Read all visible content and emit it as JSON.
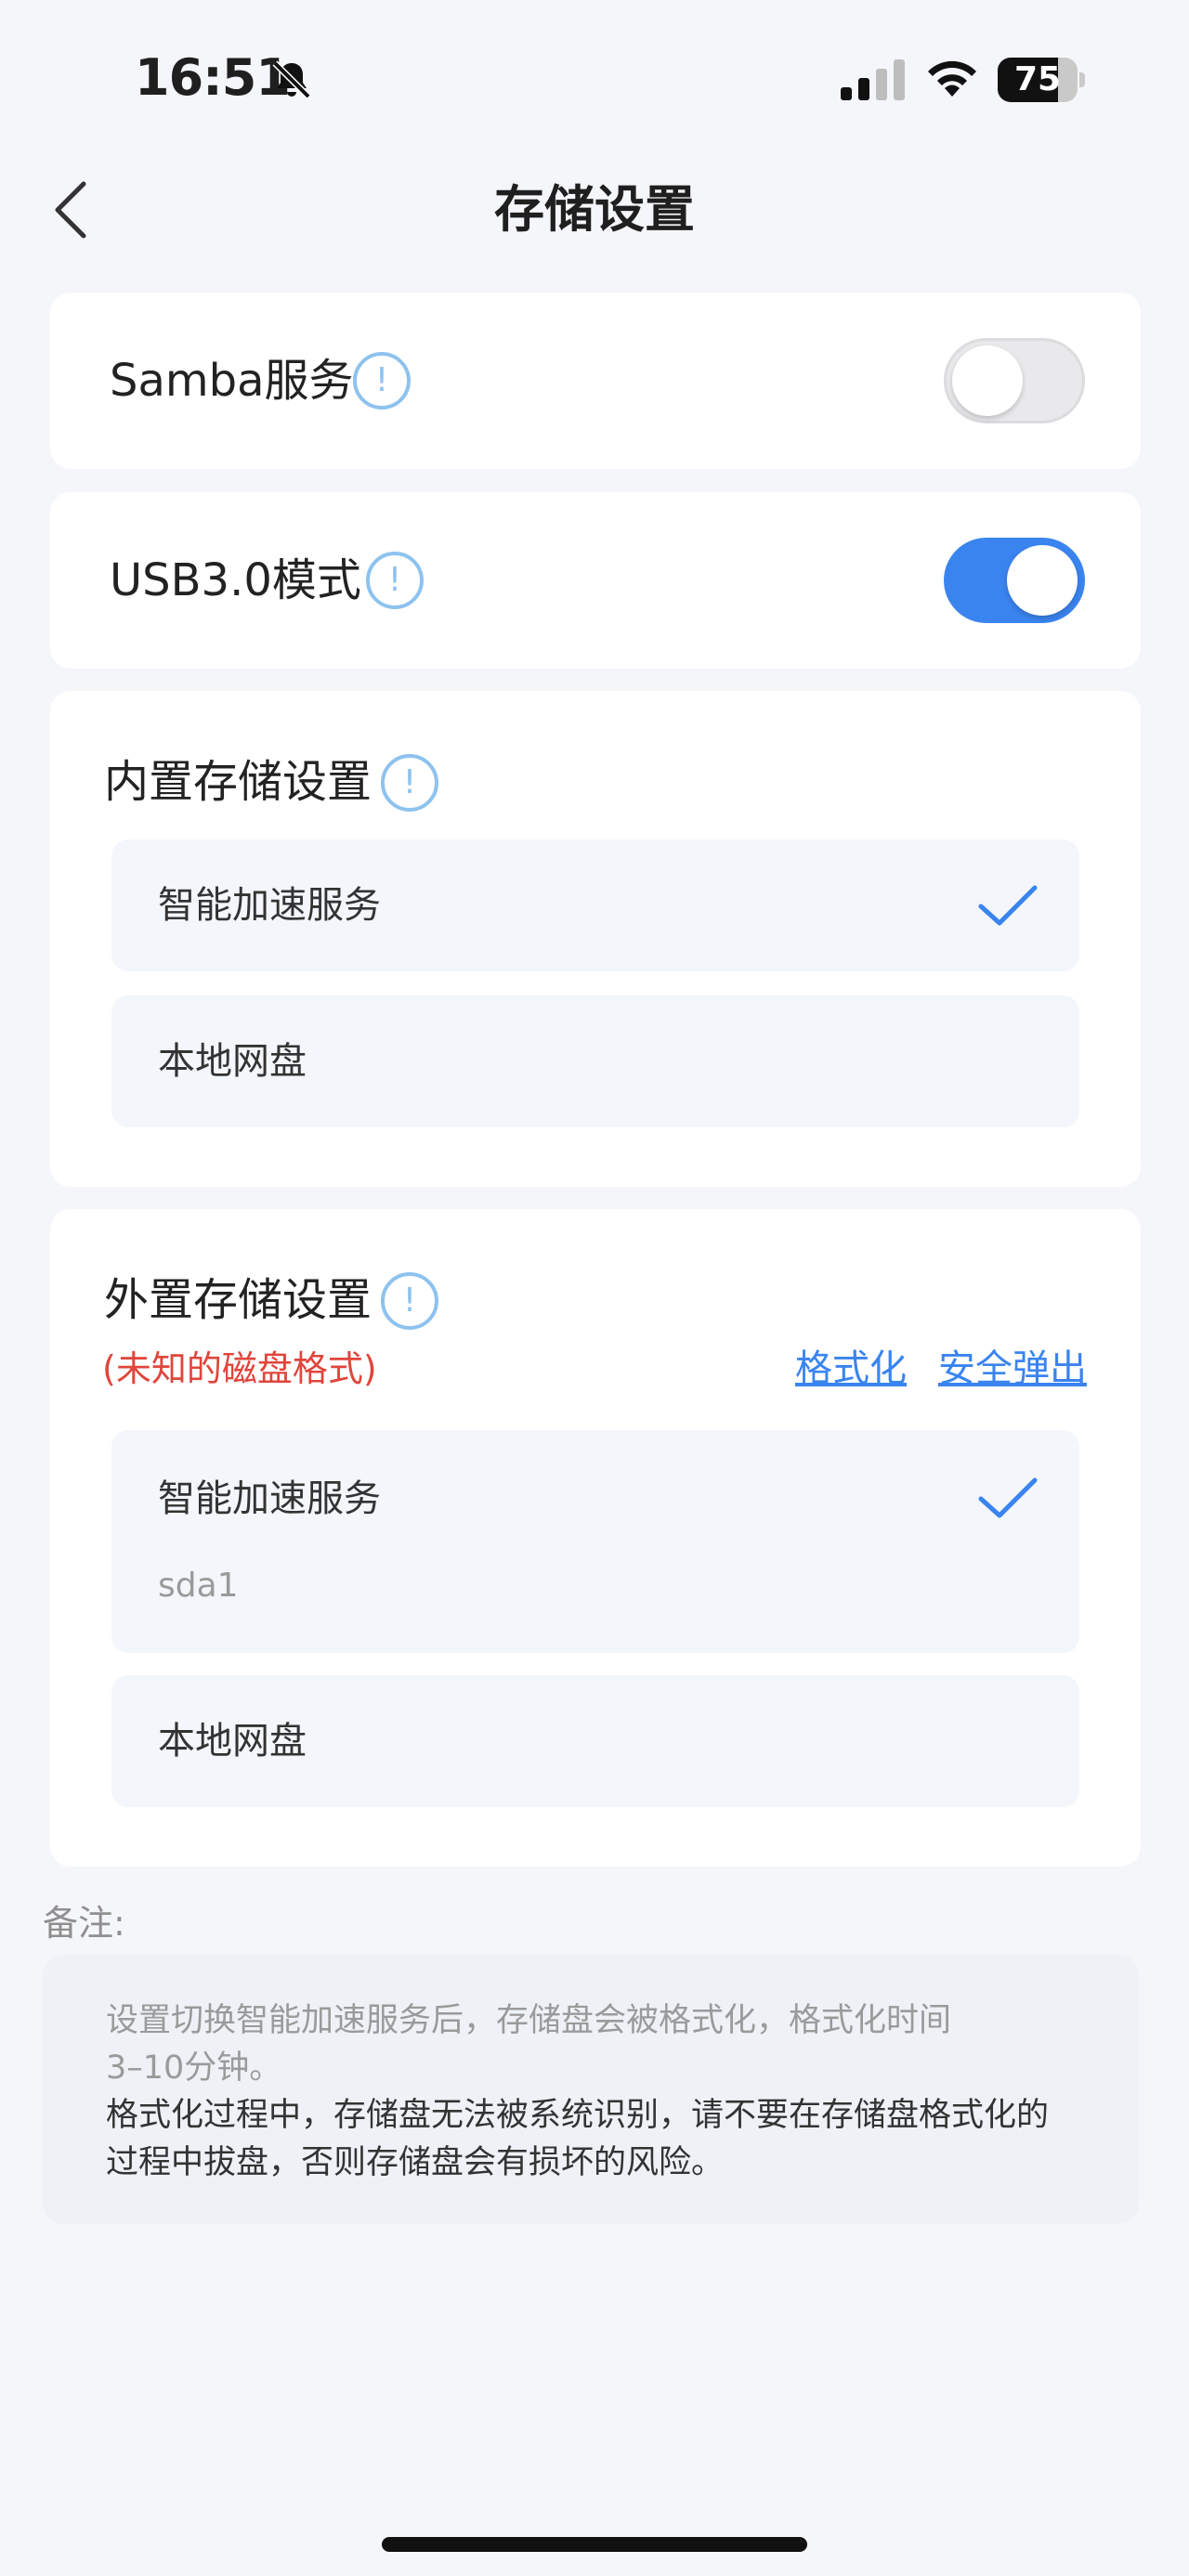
{
  "status_bar": {
    "time": "16:51",
    "battery": "75",
    "battery_level": 0.75,
    "icons": [
      "bell-slash-icon",
      "signal-icon",
      "wifi-icon",
      "battery-icon"
    ]
  },
  "nav": {
    "title": "存储设置",
    "back_icon": "chevron-left-icon"
  },
  "samba": {
    "label": "Samba服务",
    "info_glyph": "!",
    "enabled": false
  },
  "usb": {
    "label": "USB3.0模式",
    "info_glyph": "!",
    "enabled": true
  },
  "internal_storage": {
    "title": "内置存储设置",
    "info_glyph": "!",
    "options": [
      {
        "label": "智能加速服务",
        "selected": true
      },
      {
        "label": "本地网盘",
        "selected": false
      }
    ]
  },
  "external_storage": {
    "title": "外置存储设置",
    "info_glyph": "!",
    "warning": "(未知的磁盘格式)",
    "format_link": "格式化",
    "eject_link": "安全弹出",
    "options": [
      {
        "label": "智能加速服务",
        "sub": "sda1",
        "selected": true
      },
      {
        "label": "本地网盘",
        "selected": false
      }
    ]
  },
  "notes": {
    "label": "备注:",
    "lines": [
      "设置切换智能加速服务后，存储盘会被格式化，格式化时间",
      "3–10分钟。",
      "格式化过程中，存储盘无法被系统识别，请不要在存储盘格式化的",
      "过程中拔盘，否则存储盘会有损坏的风险。"
    ]
  },
  "colors": {
    "accent": "#3a84ef",
    "info": "#8ec2ee",
    "warning": "#e0453c",
    "background": "#f5f6f9",
    "card": "#ffffff",
    "option_bg": "#f3f6fa"
  }
}
